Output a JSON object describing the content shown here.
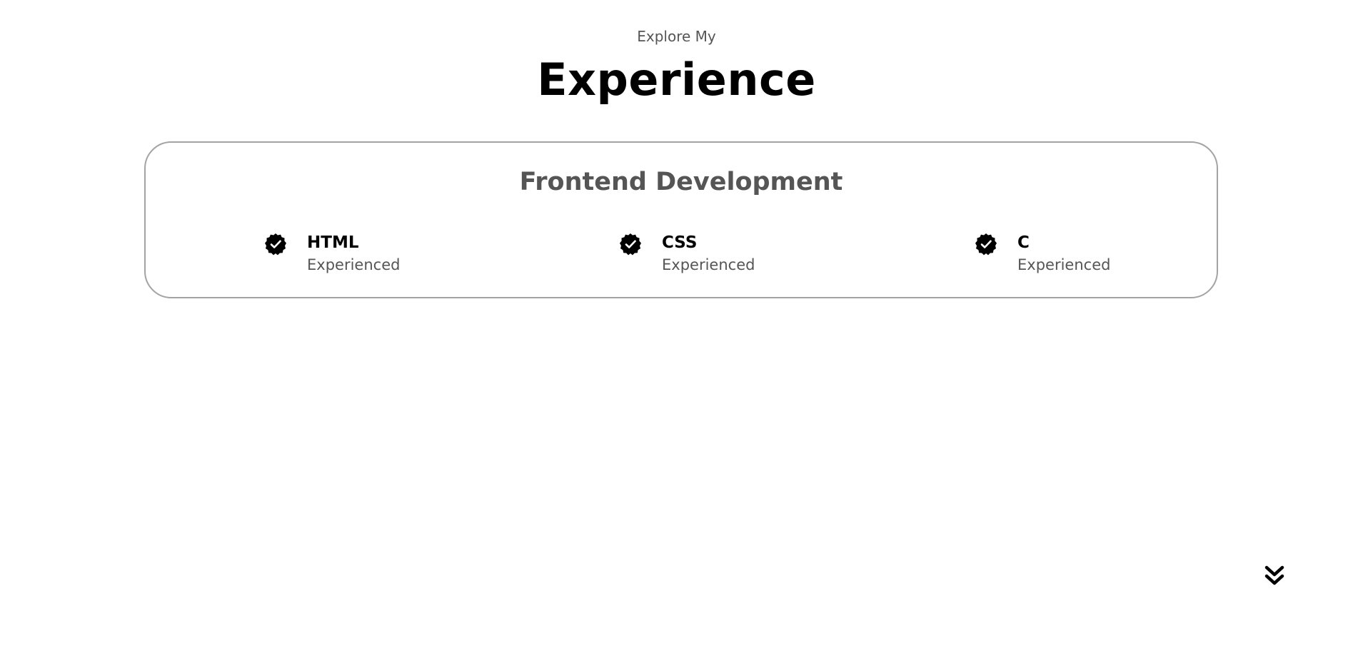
{
  "section": {
    "subtitle": "Explore My",
    "title": "Experience"
  },
  "card": {
    "title": "Frontend Development",
    "skills": [
      {
        "name": "HTML",
        "level": "Experienced",
        "icon": "verified-badge-icon"
      },
      {
        "name": "CSS",
        "level": "Experienced",
        "icon": "verified-badge-icon"
      },
      {
        "name": "C",
        "level": "Experienced",
        "icon": "verified-badge-icon"
      }
    ]
  },
  "scroll_button": {
    "icon": "double-chevron-down-icon"
  },
  "colors": {
    "text_primary": "#000000",
    "text_secondary": "#555555",
    "card_border": "#a3a3a3",
    "background": "#ffffff"
  }
}
